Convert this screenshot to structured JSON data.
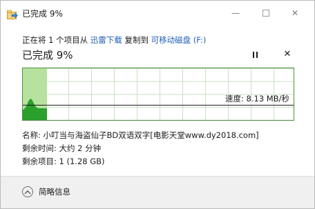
{
  "window": {
    "title": "已完成 9%",
    "minimize_label": "—",
    "close_label": "✕",
    "icon": "copy-folder-icon"
  },
  "copy_info": {
    "prefix": "正在将 1 个项目从 ",
    "source": "迅雷下载",
    "middle": " 复制到 ",
    "destination": "可移动磁盘 (F:)"
  },
  "status": {
    "title": "已完成 9%",
    "pause_icon": "pause-icon",
    "stop_label": "✕",
    "progress": 0.09
  },
  "graph": {
    "speed_label": "速度: 8.13 MB/秒",
    "accent": "#2ba02b",
    "fill": "#b7e19e"
  },
  "details": {
    "name_line": "名称: 小叮当与海盗仙子BD双语双字[电影天堂www.dy2018.com]",
    "time_line": "剩余时间: 大约 2 分钟",
    "items_line": "剩余项目: 1 (1.28 GB)"
  },
  "footer": {
    "toggle_label": "简略信息",
    "toggle_icon": "chevron-up-icon"
  }
}
